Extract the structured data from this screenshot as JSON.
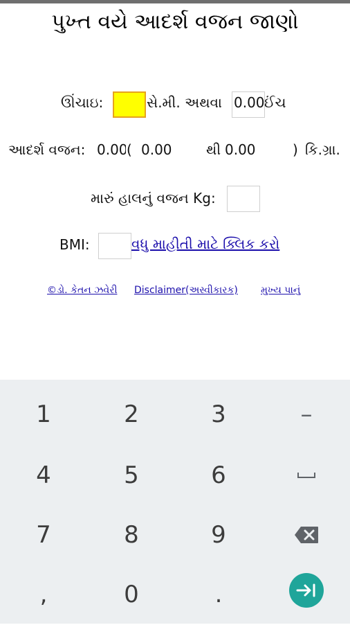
{
  "page": {
    "title": "પુખ્ત વયે આદર્શ વજન જાણો"
  },
  "height": {
    "label": "ઊંચાઇ:",
    "cm_value": "",
    "cm_unit": "સે.મી. અથવા",
    "inch_value": "0.00",
    "inch_unit": "ઈંચ"
  },
  "ideal_weight": {
    "label": "આદર્શ વજન:",
    "value": "0.00",
    "open_paren": "(",
    "min": "0.00",
    "to": "થી",
    "max": "0.00",
    "close_paren": ")",
    "unit": "કિ.ગ્રા."
  },
  "current_weight": {
    "label": "મારું હાલનું વજન Kg:",
    "value": ""
  },
  "bmi": {
    "label": "BMI:",
    "value": "",
    "info_link": "વધુ માહીતી માટે ક્લિક કરો"
  },
  "footer": {
    "links": [
      "©ડો. કેતન ઝવેરી",
      "Disclaimer(અસ્વીકારક)",
      "મુખ્ય પાનું"
    ]
  },
  "keyboard": {
    "keys": [
      "1",
      "2",
      "3",
      "–",
      "4",
      "5",
      "6",
      "␣",
      "7",
      "8",
      "9",
      "⌫",
      ",",
      "0",
      ".",
      "⇥"
    ],
    "accent_color": "#1fa59a"
  },
  "colors": {
    "input_highlight": "#ffff00",
    "focus_border": "#e6a21e",
    "link": "#1a0dab",
    "keyboard_bg": "#eceff1"
  }
}
